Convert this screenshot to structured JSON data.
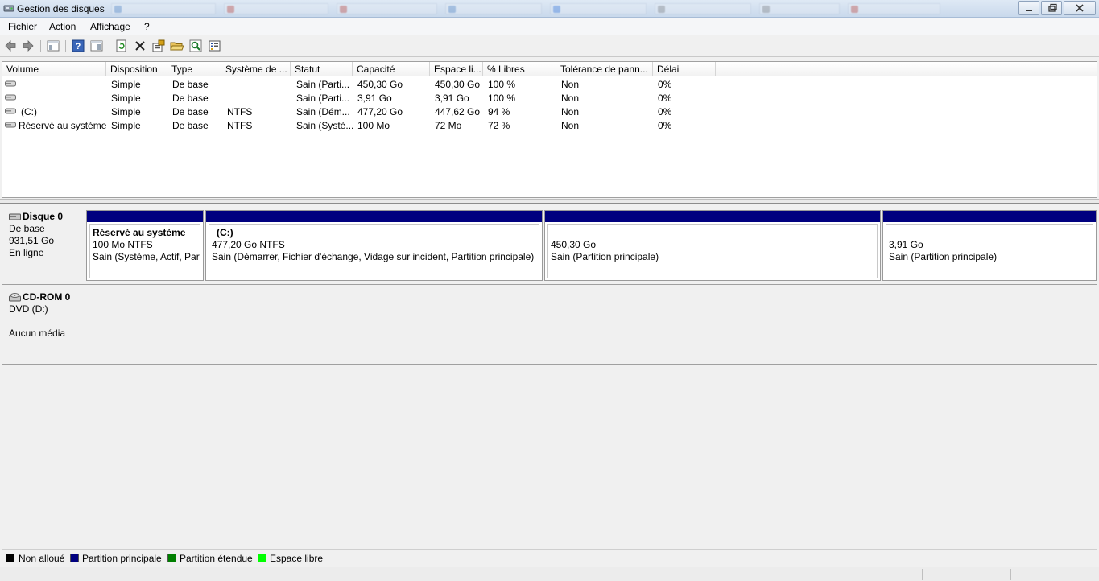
{
  "window": {
    "title": "Gestion des disques",
    "buttons": [
      "minimize",
      "restore",
      "close"
    ]
  },
  "menu": [
    "Fichier",
    "Action",
    "Affichage",
    "?"
  ],
  "toolbar": {
    "icons": [
      "back-arrow-icon",
      "forward-arrow-icon",
      "console-tree-icon",
      "help-icon",
      "show-hide-icon",
      "refresh-icon",
      "delete-icon",
      "properties-icon",
      "open-folder-icon",
      "search-icon",
      "export-list-icon"
    ]
  },
  "volumes": {
    "columns": [
      "Volume",
      "Disposition",
      "Type",
      "Système de ...",
      "Statut",
      "Capacité",
      "Espace li...",
      "% Libres",
      "Tolérance de pann...",
      "Délai"
    ],
    "rows": [
      [
        "",
        "Simple",
        "De base",
        "",
        "Sain (Parti...",
        "450,30 Go",
        "450,30 Go",
        "100 %",
        "Non",
        "0%"
      ],
      [
        "",
        "Simple",
        "De base",
        "",
        "Sain (Parti...",
        "3,91 Go",
        "3,91 Go",
        "100 %",
        "Non",
        "0%"
      ],
      [
        "(C:)",
        "Simple",
        "De base",
        "NTFS",
        "Sain (Dém...",
        "477,20 Go",
        "447,62 Go",
        "94 %",
        "Non",
        "0%"
      ],
      [
        "Réservé au système",
        "Simple",
        "De base",
        "NTFS",
        "Sain (Systè...",
        "100 Mo",
        "72 Mo",
        "72 %",
        "Non",
        "0%"
      ]
    ]
  },
  "disks": [
    {
      "name": "Disque 0",
      "type": "De base",
      "size": "931,51 Go",
      "status": "En ligne",
      "partitions": [
        {
          "name": "Réservé au système",
          "size": "100 Mo NTFS",
          "status": "Sain (Système, Actif, Part"
        },
        {
          "name": "(C:)",
          "size": "477,20 Go NTFS",
          "status": "Sain (Démarrer, Fichier d'échange, Vidage sur incident, Partition principale)"
        },
        {
          "name": "",
          "size": "450,30 Go",
          "status": "Sain (Partition principale)"
        },
        {
          "name": "",
          "size": "3,91 Go",
          "status": "Sain (Partition principale)"
        }
      ]
    },
    {
      "name": "CD-ROM 0",
      "type": "DVD (D:)",
      "media": "Aucun média"
    }
  ],
  "legend": [
    {
      "label": "Non alloué",
      "color": "#000000"
    },
    {
      "label": "Partition principale",
      "color": "#00007f"
    },
    {
      "label": "Partition étendue",
      "color": "#007f00"
    },
    {
      "label": "Espace libre",
      "color": "#00ff00"
    }
  ]
}
